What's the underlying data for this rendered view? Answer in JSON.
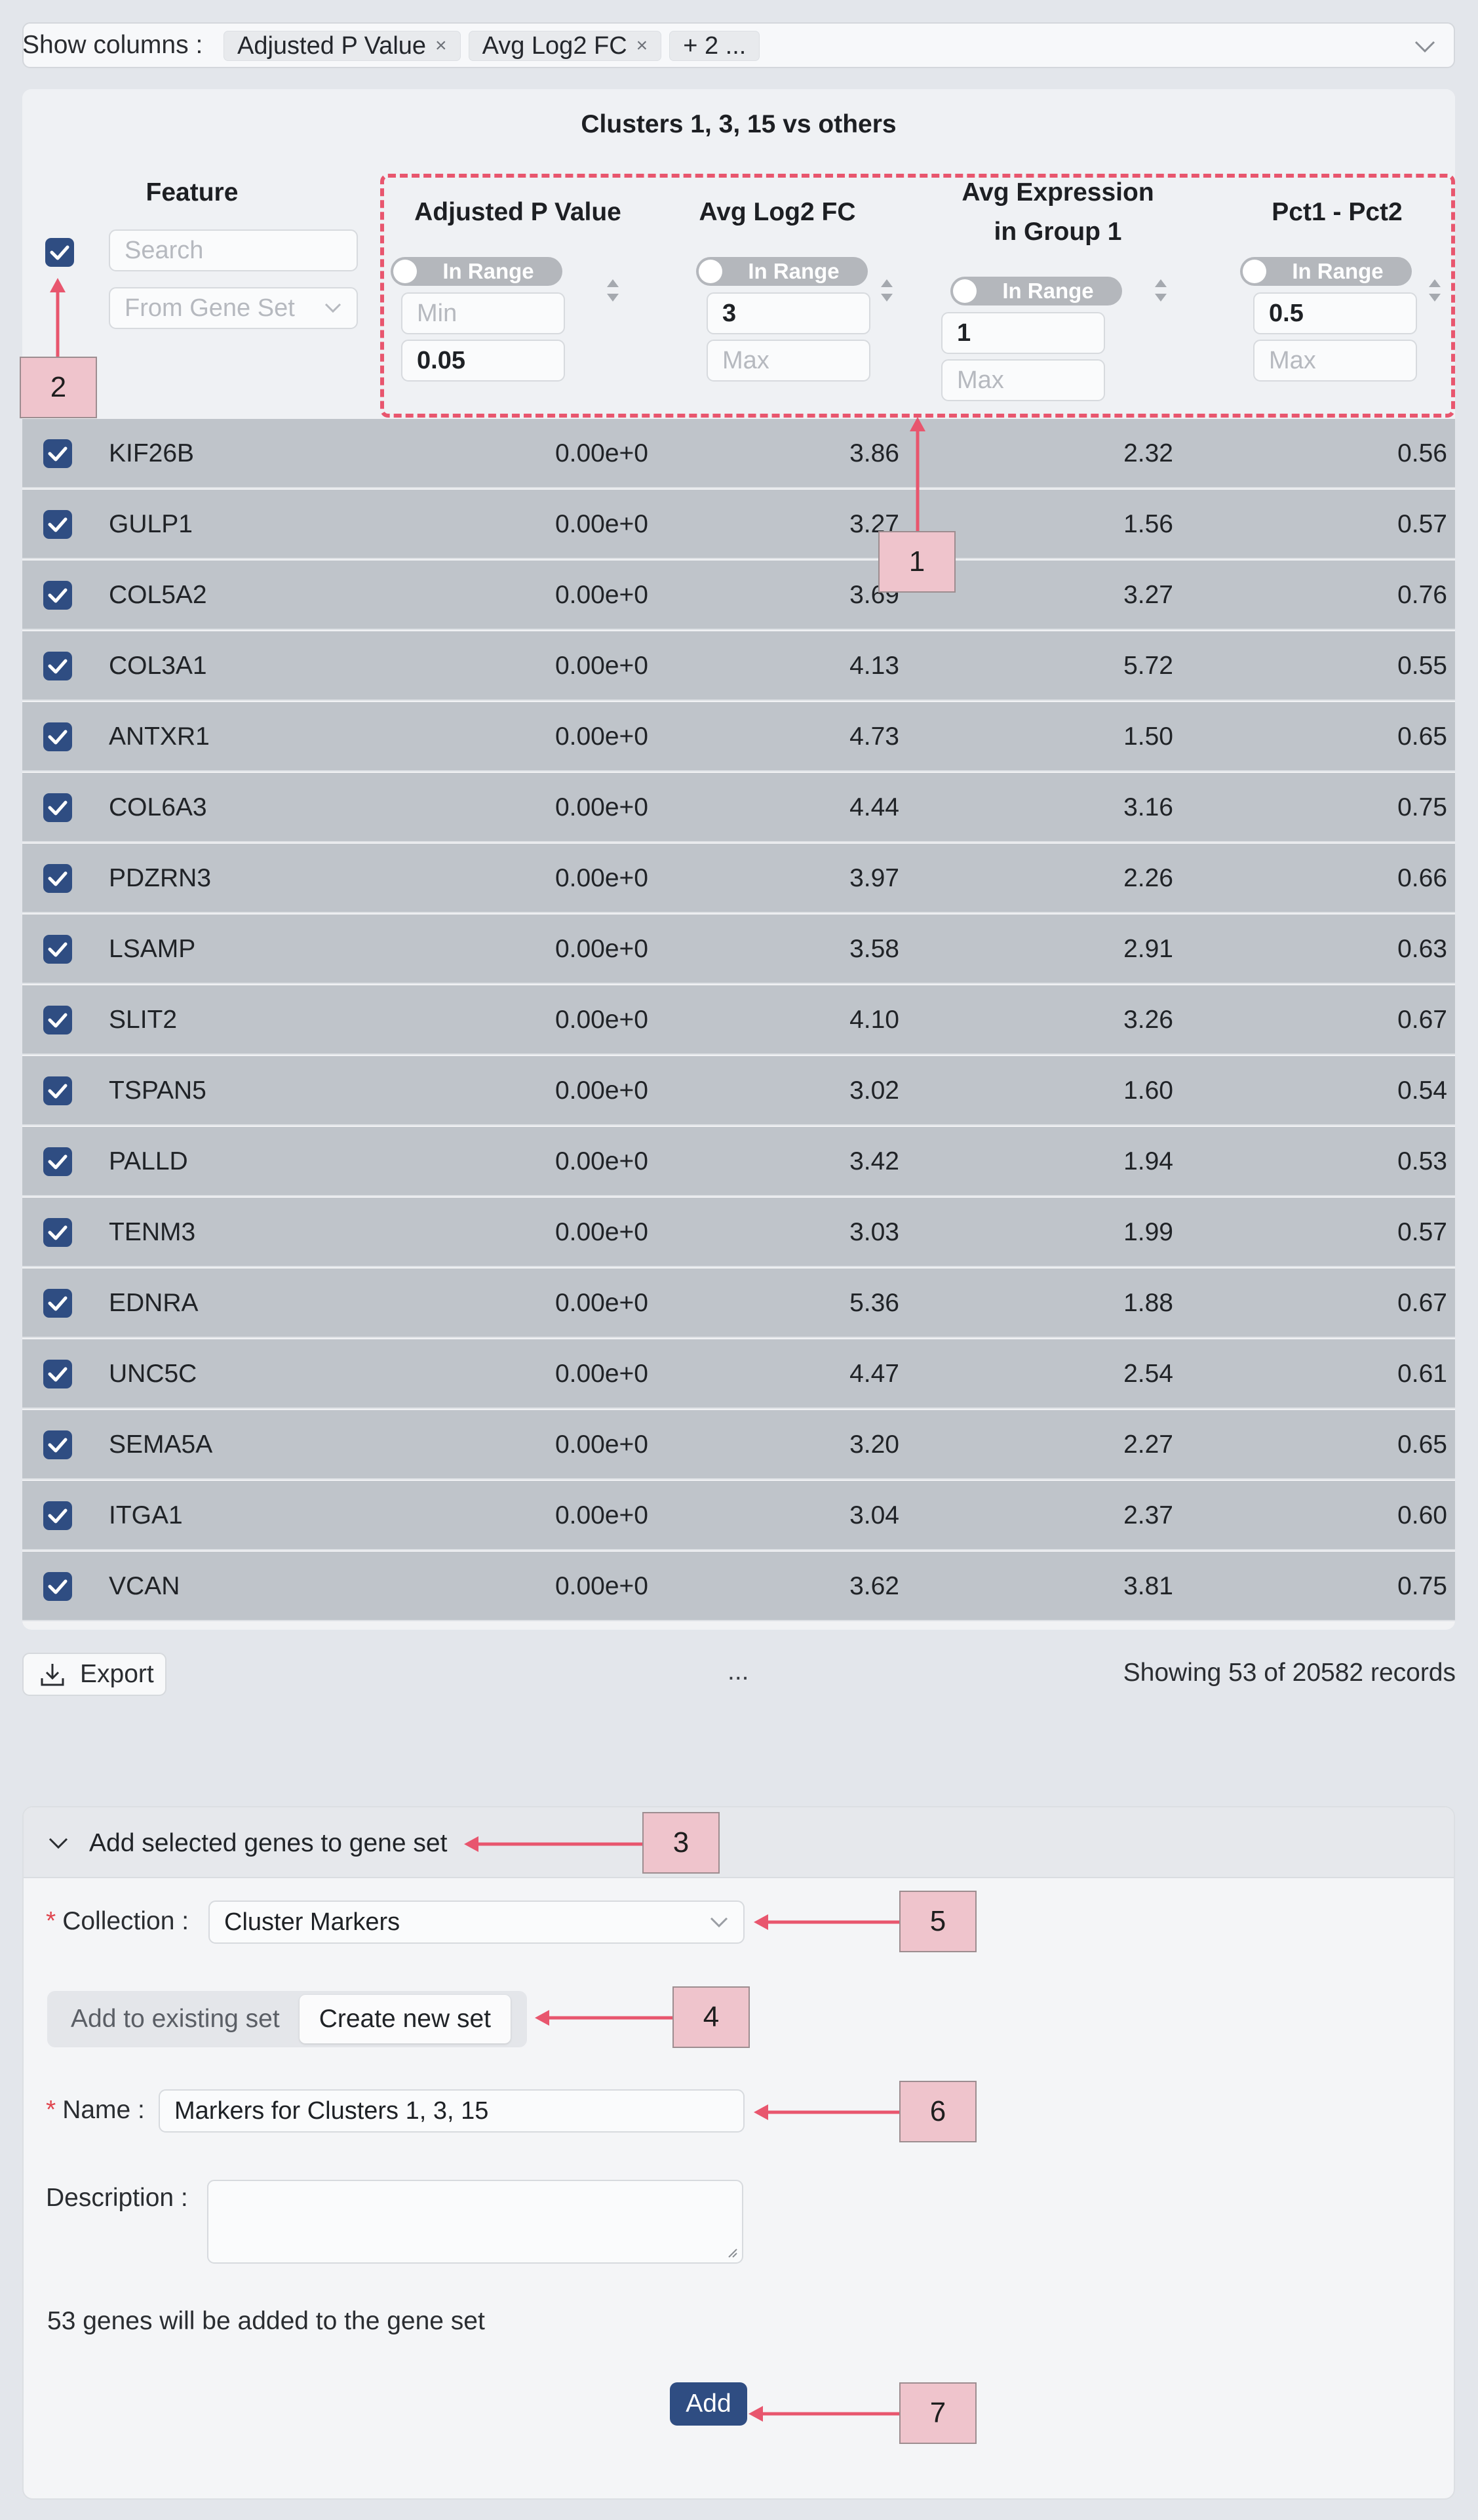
{
  "column_picker": {
    "label": "Show columns :",
    "tags": [
      {
        "label": "Adjusted P Value",
        "close": "×"
      },
      {
        "label": "Avg Log2 FC",
        "close": "×"
      }
    ],
    "more": "+ 2 ..."
  },
  "table": {
    "group_title": "Clusters 1, 3, 15 vs others",
    "feature": {
      "title": "Feature",
      "search_placeholder": "Search",
      "gene_set_placeholder": "From Gene Set"
    },
    "filters": {
      "adj_p": {
        "title": "Adjusted P Value",
        "toggle": "In Range",
        "min": "Min",
        "max": "0.05"
      },
      "log2fc": {
        "title": "Avg Log2 FC",
        "toggle": "In Range",
        "min": "3",
        "max": "Max"
      },
      "avg_expr": {
        "title_1": "Avg Expression",
        "title_2": "in Group 1",
        "toggle": "In Range",
        "min": "1",
        "max": "Max"
      },
      "pct": {
        "title": "Pct1 - Pct2",
        "toggle": "In Range",
        "min": "0.5",
        "max": "Max"
      }
    },
    "rows": [
      {
        "feature": "KIF26B",
        "adj_p": "0.00e+0",
        "log2fc": "3.86",
        "avg_expr": "2.32",
        "pct": "0.56"
      },
      {
        "feature": "GULP1",
        "adj_p": "0.00e+0",
        "log2fc": "3.27",
        "avg_expr": "1.56",
        "pct": "0.57"
      },
      {
        "feature": "COL5A2",
        "adj_p": "0.00e+0",
        "log2fc": "3.69",
        "avg_expr": "3.27",
        "pct": "0.76"
      },
      {
        "feature": "COL3A1",
        "adj_p": "0.00e+0",
        "log2fc": "4.13",
        "avg_expr": "5.72",
        "pct": "0.55"
      },
      {
        "feature": "ANTXR1",
        "adj_p": "0.00e+0",
        "log2fc": "4.73",
        "avg_expr": "1.50",
        "pct": "0.65"
      },
      {
        "feature": "COL6A3",
        "adj_p": "0.00e+0",
        "log2fc": "4.44",
        "avg_expr": "3.16",
        "pct": "0.75"
      },
      {
        "feature": "PDZRN3",
        "adj_p": "0.00e+0",
        "log2fc": "3.97",
        "avg_expr": "2.26",
        "pct": "0.66"
      },
      {
        "feature": "LSAMP",
        "adj_p": "0.00e+0",
        "log2fc": "3.58",
        "avg_expr": "2.91",
        "pct": "0.63"
      },
      {
        "feature": "SLIT2",
        "adj_p": "0.00e+0",
        "log2fc": "4.10",
        "avg_expr": "3.26",
        "pct": "0.67"
      },
      {
        "feature": "TSPAN5",
        "adj_p": "0.00e+0",
        "log2fc": "3.02",
        "avg_expr": "1.60",
        "pct": "0.54"
      },
      {
        "feature": "PALLD",
        "adj_p": "0.00e+0",
        "log2fc": "3.42",
        "avg_expr": "1.94",
        "pct": "0.53"
      },
      {
        "feature": "TENM3",
        "adj_p": "0.00e+0",
        "log2fc": "3.03",
        "avg_expr": "1.99",
        "pct": "0.57"
      },
      {
        "feature": "EDNRA",
        "adj_p": "0.00e+0",
        "log2fc": "5.36",
        "avg_expr": "1.88",
        "pct": "0.67"
      },
      {
        "feature": "UNC5C",
        "adj_p": "0.00e+0",
        "log2fc": "4.47",
        "avg_expr": "2.54",
        "pct": "0.61"
      },
      {
        "feature": "SEMA5A",
        "adj_p": "0.00e+0",
        "log2fc": "3.20",
        "avg_expr": "2.27",
        "pct": "0.65"
      },
      {
        "feature": "ITGA1",
        "adj_p": "0.00e+0",
        "log2fc": "3.04",
        "avg_expr": "2.37",
        "pct": "0.60"
      },
      {
        "feature": "VCAN",
        "adj_p": "0.00e+0",
        "log2fc": "3.62",
        "avg_expr": "3.81",
        "pct": "0.75"
      }
    ]
  },
  "footer": {
    "export_label": "Export",
    "ellipsis": "...",
    "records": "Showing 53 of 20582 records"
  },
  "gene_set_panel": {
    "title": "Add selected genes to gene set",
    "collection_label": "Collection :",
    "collection_value": "Cluster Markers",
    "mode_options": [
      "Add to existing set",
      "Create new set"
    ],
    "mode_selected": "Create new set",
    "name_label": "Name :",
    "name_value": "Markers for Clusters 1, 3, 15",
    "description_label": "Description :",
    "info": "53 genes will be added to the gene set",
    "add_label": "Add"
  },
  "annotations": [
    "1",
    "2",
    "3",
    "4",
    "5",
    "6",
    "7"
  ],
  "colors": {
    "accent": "#2f4d82",
    "annotation_fill": "#efc4cc",
    "annotation_arrow": "#e8566e",
    "row_bg": "#bfc4ca"
  }
}
